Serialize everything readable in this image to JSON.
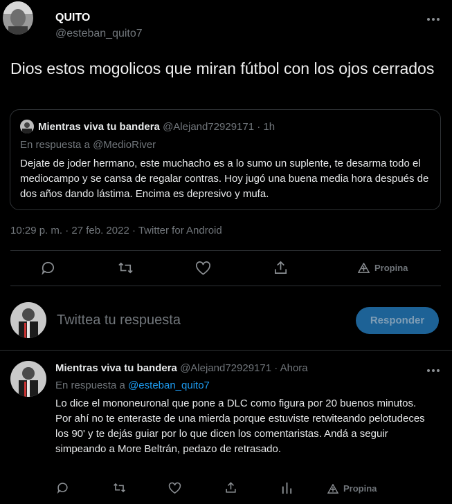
{
  "main_tweet": {
    "author_name": "QUITO",
    "author_handle": "@esteban_quito7",
    "text": "Dios estos mogolicos que miran fútbol con los ojos cerrados",
    "meta": "10:29 p. m. · 27 feb. 2022 · Twitter for Android"
  },
  "quoted_tweet": {
    "author_name": "Mientras viva tu bandera",
    "author_handle": "@Alejand72929171",
    "time": "· 1h",
    "reply_to": "En respuesta a @MedioRiver",
    "text": "Dejate de joder hermano, este muchacho es a lo sumo un suplente, te desarma todo el mediocampo y se cansa de regalar contras. Hoy jugó una buena media hora después de dos años dando lástima. Encima es depresivo y mufa."
  },
  "actions": {
    "tip_label": "Propina"
  },
  "composer": {
    "placeholder": "Twittea tu respuesta",
    "button_label": "Responder"
  },
  "reply_tweet": {
    "author_name": "Mientras viva tu bandera",
    "author_handle": "@Alejand72929171",
    "time": "· Ahora",
    "reply_prefix": "En respuesta a",
    "reply_to": "@esteban_quito7",
    "text": "Lo dice el mononeuronal que pone a DLC como figura por 20 buenos minutos. Por ahí no te enteraste de una mierda porque estuviste retwiteando pelotudeces los 90' y te dejás guiar por lo que dicen los comentaristas. Andá a seguir simpeando a More Beltrán, pedazo de retrasado."
  },
  "icons": {
    "more": "more-dots-icon",
    "reply": "reply-bubble-icon",
    "retweet": "retweet-icon",
    "like": "heart-icon",
    "share": "share-icon",
    "analytics": "analytics-icon",
    "tip": "tip-icon"
  },
  "colors": {
    "background": "#000000",
    "text": "#e7e9ea",
    "muted": "#71767b",
    "link": "#1d9bf0",
    "button_bg": "#1d6296",
    "border": "#2f3336"
  }
}
